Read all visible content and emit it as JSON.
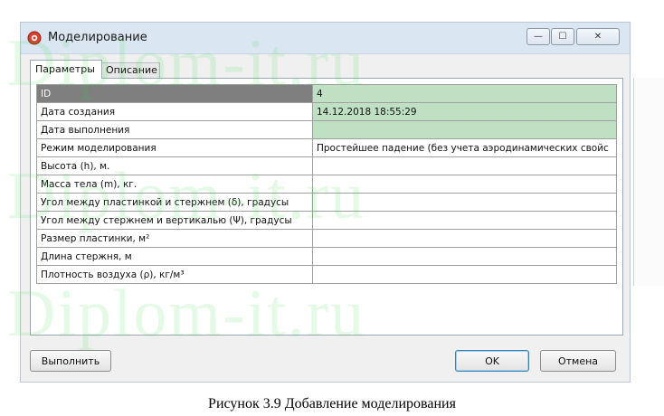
{
  "window": {
    "title": "Моделирование",
    "controls": {
      "minimize": "—",
      "maximize": "☐",
      "close": "✕"
    }
  },
  "tabs": [
    {
      "label": "Параметры",
      "active": true
    },
    {
      "label": "Описание",
      "active": false
    }
  ],
  "grid": {
    "rows": [
      {
        "label": "ID",
        "value": "4"
      },
      {
        "label": "Дата создания",
        "value": "14.12.2018 18:55:29"
      },
      {
        "label": "Дата выполнения",
        "value": ""
      },
      {
        "label": "Режим моделирования",
        "value": "Простейшее падение (без учета аэродинамических свойс"
      },
      {
        "label": "Высота (h), м.",
        "value": ""
      },
      {
        "label": "Масса тела (m), кг.",
        "value": ""
      },
      {
        "label": "Угол между пластинкой и стержнем (δ), градусы",
        "value": ""
      },
      {
        "label": "Угол между стержнем и вертикалью (Ψ), градусы",
        "value": ""
      },
      {
        "label": "Размер пластинки, м²",
        "value": ""
      },
      {
        "label": "Длина стержня, м",
        "value": ""
      },
      {
        "label": "Плотность воздуха (ρ), кг/м³",
        "value": ""
      }
    ]
  },
  "buttons": {
    "execute": "Выполнить",
    "ok": "OK",
    "cancel": "Отмена"
  },
  "caption": "Рисунок 3.9 Добавление моделирования",
  "watermark": "Diplom-it.ru",
  "colors": {
    "header_row": "#7f7f7f",
    "readonly_cell": "#bfe0c3",
    "watermark": "#2fd83a"
  }
}
